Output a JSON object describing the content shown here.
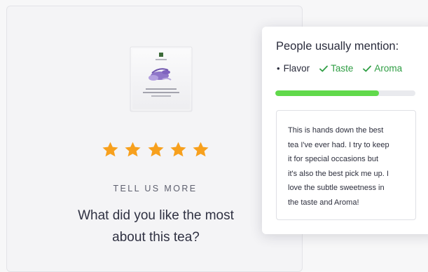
{
  "product": {
    "image_label": "EARL GREY WITH LAVENDER",
    "rating": 5,
    "max_rating": 5
  },
  "prompt": {
    "heading": "TELL US MORE",
    "question": "What did you like the most about this tea?"
  },
  "insights": {
    "title": "People usually mention:",
    "mentions": [
      {
        "label": "Flavor",
        "state": "neutral"
      },
      {
        "label": "Taste",
        "state": "checked"
      },
      {
        "label": "Aroma",
        "state": "checked"
      }
    ],
    "progress_fraction": 0.74,
    "review_text": "This is hands down the best\ntea I've ever had. I try to keep\nit for special occasions but\nit's also the best pick me up. I\nlove the subtle sweetness in\nthe taste and Aroma!"
  },
  "colors": {
    "star": "#f7a01d",
    "check": "#2f9e44",
    "progress": "#61d94b"
  }
}
